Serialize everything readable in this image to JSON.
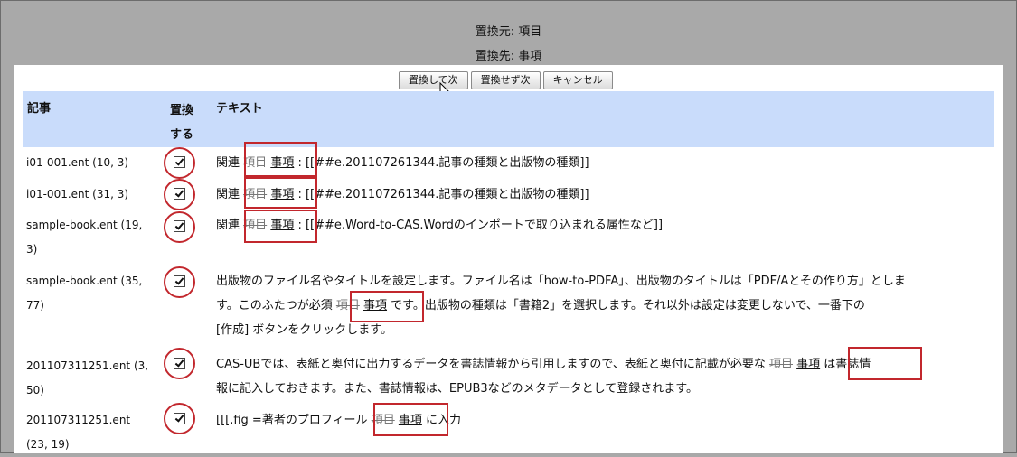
{
  "header": {
    "source_line": "置換元: 項目",
    "target_line": "置換先: 事項"
  },
  "buttons": {
    "replace_next": "置換して次",
    "skip_next": "置換せず次",
    "cancel": "キャンセル"
  },
  "table": {
    "col_article": "記事",
    "col_replace_1": "置換",
    "col_replace_2": "する",
    "col_text": "テキスト"
  },
  "rows": [
    {
      "article": "i01-001.ent (10, 3)",
      "checked": true,
      "pre": "関連",
      "old": "項目",
      "new": "事項",
      "post": ": [[##e.201107261344.記事の種類と出版物の種類]]"
    },
    {
      "article": "i01-001.ent (31, 3)",
      "checked": true,
      "pre": "関連",
      "old": "項目",
      "new": "事項",
      "post": ": [[##e.201107261344.記事の種類と出版物の種類]]"
    },
    {
      "article_1": "sample-book.ent (19,",
      "article_2": "3)",
      "checked": true,
      "pre": "関連",
      "old": "項目",
      "new": "事項",
      "post": ": [[##e.Word-to-CAS.Wordのインポートで取り込まれる属性など]]"
    },
    {
      "article_1": "sample-book.ent (35,",
      "article_2": "77)",
      "checked": true,
      "line1": "出版物のファイル名やタイトルを設定します。ファイル名は「how-to-PDFA」、出版物のタイトルは「PDF/Aとその作り方」としま",
      "line2_pre": "す。このふたつが必須",
      "old": "項目",
      "new": "事項",
      "line2_post": "です。出版物の種類は「書籍2」を選択します。それ以外は設定は変更しないで、一番下の",
      "line3": "[作成] ボタンをクリックします。"
    },
    {
      "article_1": "201107311251.ent (3,",
      "article_2": "50)",
      "checked": true,
      "line1_pre": "CAS-UBでは、表紙と奥付に出力するデータを書誌情報から引用しますので、表紙と奥付に記載が必要な",
      "old": "項目",
      "new": "事項",
      "line1_post": "は書誌情",
      "line2": "報に記入しておきます。また、書誌情報は、EPUB3などのメタデータとして登録されます。"
    },
    {
      "article_1": "201107311251.ent",
      "article_2": "(23, 19)",
      "checked": true,
      "pre": "[[[.fig =著者のプロフィール",
      "old": "項目",
      "new": "事項",
      "post": "に入力"
    }
  ]
}
